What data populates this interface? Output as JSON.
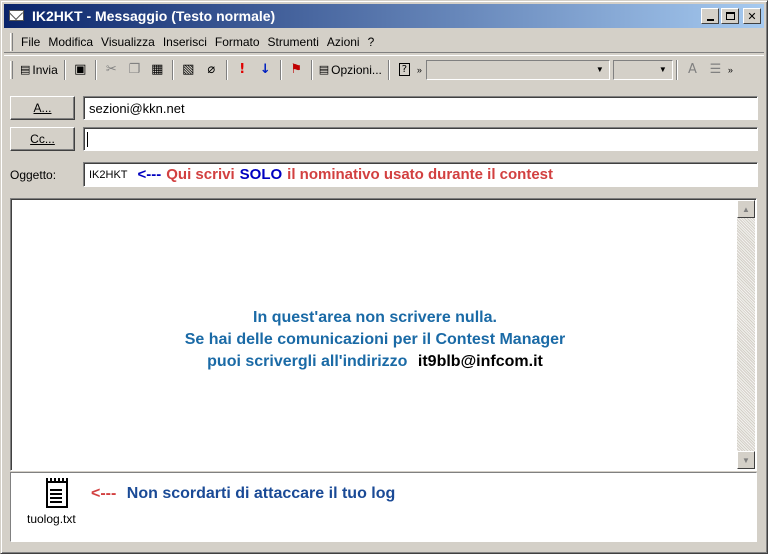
{
  "window": {
    "title": "IK2HKT - Messaggio (Testo normale)"
  },
  "menu": {
    "items": [
      "File",
      "Modifica",
      "Visualizza",
      "Inserisci",
      "Formato",
      "Strumenti",
      "Azioni",
      "?"
    ]
  },
  "toolbar": {
    "send_label": "Invia",
    "options_label": "Opzioni..."
  },
  "header": {
    "to_button": "A...",
    "to_value": "sezioni@kkn.net",
    "cc_button": "Cc...",
    "cc_value": "",
    "subject_label": "Oggetto:",
    "subject_value": "IK2HKT",
    "subject_note_arrow": "<---",
    "subject_note_pre": "Qui scrivi",
    "subject_note_bold": "SOLO",
    "subject_note_post": "il nominativo usato durante il contest"
  },
  "body": {
    "line1": "In quest'area non scrivere nulla.",
    "line2": "Se hai delle comunicazioni per il Contest Manager",
    "line3": "puoi scrivergli all'indirizzo",
    "email": "it9blb@infcom.it"
  },
  "attachment": {
    "filename": "tuolog.txt",
    "note_arrow": "<---",
    "note_text": "Non scordarti di attaccare il tuo log"
  },
  "colors": {
    "title_start": "#0a246a",
    "title_end": "#a6caf0",
    "note_red": "#d24040",
    "note_blue": "#0000c0",
    "body_blue": "#1a6aa6"
  }
}
